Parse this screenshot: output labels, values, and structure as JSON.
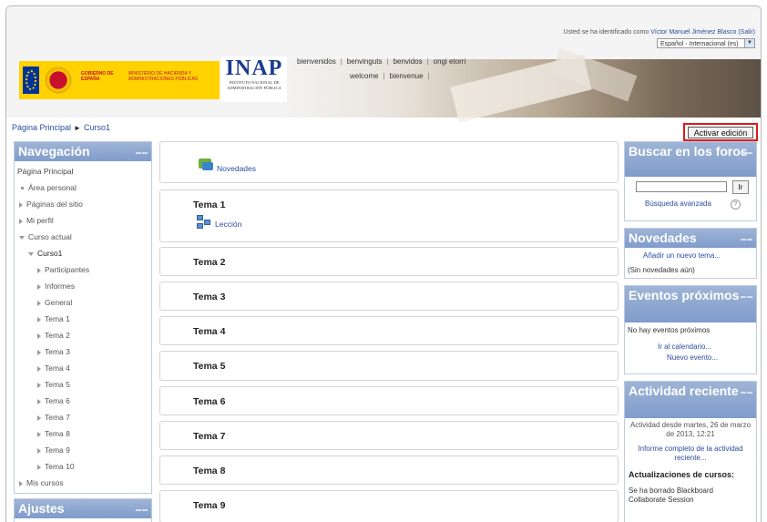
{
  "header": {
    "login_prefix": "Usted se ha identificado como",
    "user_name": "Víctor Manuel Jiménez Blasco",
    "logout": "(Salir)",
    "language": "Español - Internacional (es)",
    "welcome_row1": [
      "bienvenidos",
      "benvinguts",
      "benvidos",
      "ongi etorri"
    ],
    "welcome_row2": [
      "welcome",
      "bienvenue"
    ],
    "gov_text": "GOBIERNO DE ESPAÑA",
    "ministry_text": "MINISTERIO DE HACIENDA Y ADMINISTRACIONES PÚBLICAS",
    "inap_big": "INAP",
    "inap_small": "INSTITUTO NACIONAL DE ADMINISTRACIÓN PÚBLICA"
  },
  "breadcrumb": {
    "home": "Página Principal",
    "separator": "►",
    "current": "Curso1"
  },
  "edit_button": "Activar edición",
  "navigation": {
    "title": "Navegación",
    "home": "Página Principal",
    "items": [
      {
        "label": "Área personal",
        "indent": 0,
        "marker": "bullet"
      },
      {
        "label": "Páginas del sitio",
        "indent": 0,
        "marker": "right"
      },
      {
        "label": "Mi perfil",
        "indent": 0,
        "marker": "right"
      },
      {
        "label": "Curso actual",
        "indent": 0,
        "marker": "down"
      },
      {
        "label": "Curso1",
        "indent": 1,
        "marker": "down"
      },
      {
        "label": "Participantes",
        "indent": 2,
        "marker": "right"
      },
      {
        "label": "Informes",
        "indent": 2,
        "marker": "right"
      },
      {
        "label": "General",
        "indent": 2,
        "marker": "right"
      },
      {
        "label": "Tema 1",
        "indent": 2,
        "marker": "right"
      },
      {
        "label": "Tema 2",
        "indent": 2,
        "marker": "right"
      },
      {
        "label": "Tema 3",
        "indent": 2,
        "marker": "right"
      },
      {
        "label": "Tema 4",
        "indent": 2,
        "marker": "right"
      },
      {
        "label": "Tema 5",
        "indent": 2,
        "marker": "right"
      },
      {
        "label": "Tema 6",
        "indent": 2,
        "marker": "right"
      },
      {
        "label": "Tema 7",
        "indent": 2,
        "marker": "right"
      },
      {
        "label": "Tema 8",
        "indent": 2,
        "marker": "right"
      },
      {
        "label": "Tema 9",
        "indent": 2,
        "marker": "right"
      },
      {
        "label": "Tema 10",
        "indent": 2,
        "marker": "right"
      },
      {
        "label": "Mis cursos",
        "indent": 0,
        "marker": "right"
      }
    ]
  },
  "settings": {
    "title": "Ajustes"
  },
  "course": {
    "news_link": "Novedades",
    "sections": [
      {
        "title": "Tema 1",
        "activity": "Lección"
      },
      {
        "title": "Tema 2"
      },
      {
        "title": "Tema 3"
      },
      {
        "title": "Tema 4"
      },
      {
        "title": "Tema 5"
      },
      {
        "title": "Tema 6"
      },
      {
        "title": "Tema 7"
      },
      {
        "title": "Tema 8"
      },
      {
        "title": "Tema 9"
      }
    ]
  },
  "search_forums": {
    "title": "Buscar en los foros",
    "button": "Ir",
    "advanced": "Búsqueda avanzada",
    "input_value": ""
  },
  "news_block": {
    "title": "Novedades",
    "add_link": "Añadir un nuevo tema...",
    "empty": "(Sin novedades aún)"
  },
  "events": {
    "title": "Eventos próximos",
    "none": "No hay eventos próximos",
    "calendar": "Ir al calendario...",
    "new_event": "Nuevo evento..."
  },
  "recent": {
    "title": "Actividad reciente",
    "since": "Actividad desde martes, 26 de marzo de 2013, 12:21",
    "full_report": "Informe completo de la actividad reciente...",
    "updates_title": "Actualizaciones de cursos:",
    "update_text": "Se ha borrado Blackboard Collaborate Session"
  }
}
